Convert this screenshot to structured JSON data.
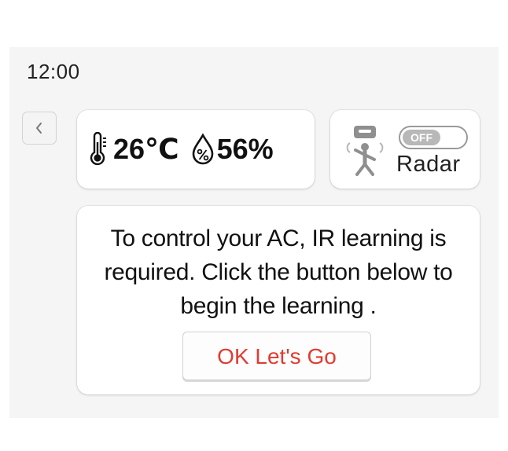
{
  "status": {
    "time": "12:00"
  },
  "navigation": {
    "back_icon": "chevron-left-icon"
  },
  "environment": {
    "thermometer_icon": "thermometer-icon",
    "temperature": "26℃",
    "humidity_icon": "humidity-drop-icon",
    "humidity": "56%"
  },
  "radar": {
    "icon": "radar-sensor-icon",
    "toggle_state": "OFF",
    "label": "Radar"
  },
  "message": {
    "text": "To control your AC,  IR learning is required. Click the button below to begin the learning .",
    "button_label": "OK Let's Go"
  },
  "colors": {
    "button_text": "#e13b30",
    "toggle_knob": "#b8b8b8",
    "screen_background": "#f5f5f5"
  }
}
